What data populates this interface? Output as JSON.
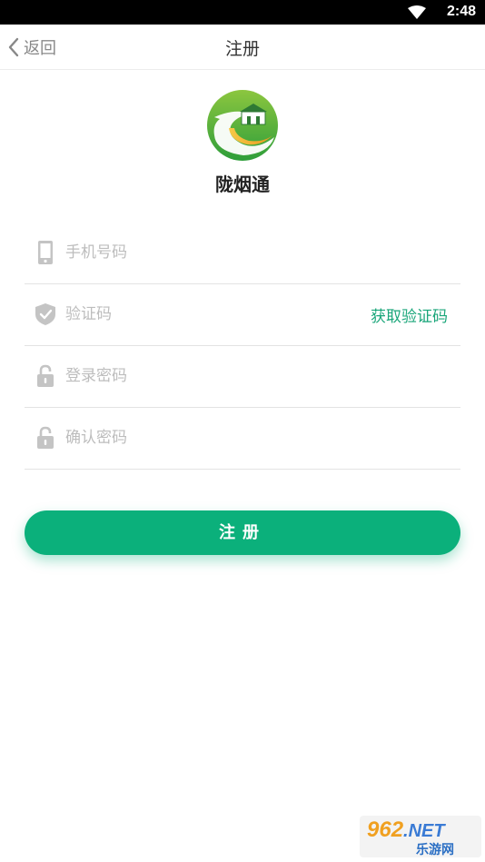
{
  "status_bar": {
    "time": "2:48",
    "icons": [
      "wifi-icon"
    ]
  },
  "nav": {
    "back_label": "返回",
    "title": "注册",
    "back_icon": "chevron-left-icon"
  },
  "app": {
    "name": "陇烟通",
    "logo": "city-gate-road-logo"
  },
  "form": {
    "phone": {
      "placeholder": "手机号码",
      "value": "",
      "icon": "phone-icon"
    },
    "code": {
      "placeholder": "验证码",
      "value": "",
      "icon": "shield-check-icon",
      "get_code_label": "获取验证码"
    },
    "password": {
      "placeholder": "登录密码",
      "value": "",
      "icon": "lock-icon"
    },
    "confirm_password": {
      "placeholder": "确认密码",
      "value": "",
      "icon": "lock-icon"
    }
  },
  "submit": {
    "label": "注册"
  },
  "watermark": {
    "brand": "962",
    "suffix": ".NET",
    "text": "乐游网"
  },
  "colors": {
    "accent": "#0bb07b",
    "link": "#1aa67a",
    "icon_gray": "#c4c4c4",
    "placeholder": "#bdbdbd"
  }
}
